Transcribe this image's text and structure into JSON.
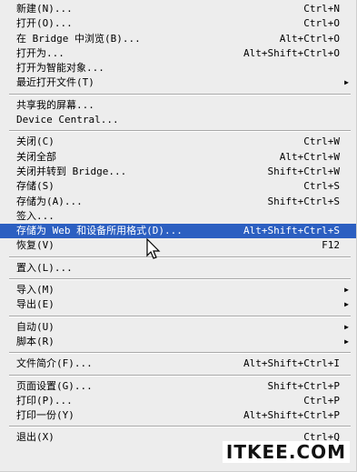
{
  "groups": [
    [
      {
        "label": "新建(N)...",
        "shortcut": "Ctrl+N"
      },
      {
        "label": "打开(O)...",
        "shortcut": "Ctrl+O"
      },
      {
        "label": "在 Bridge 中浏览(B)...",
        "shortcut": "Alt+Ctrl+O"
      },
      {
        "label": "打开为...",
        "shortcut": "Alt+Shift+Ctrl+O"
      },
      {
        "label": "打开为智能对象...",
        "shortcut": ""
      },
      {
        "label": "最近打开文件(T)",
        "shortcut": "",
        "submenu": true
      }
    ],
    [
      {
        "label": "共享我的屏幕...",
        "shortcut": ""
      },
      {
        "label": "Device Central...",
        "shortcut": ""
      }
    ],
    [
      {
        "label": "关闭(C)",
        "shortcut": "Ctrl+W"
      },
      {
        "label": "关闭全部",
        "shortcut": "Alt+Ctrl+W"
      },
      {
        "label": "关闭并转到 Bridge...",
        "shortcut": "Shift+Ctrl+W"
      },
      {
        "label": "存储(S)",
        "shortcut": "Ctrl+S"
      },
      {
        "label": "存储为(A)...",
        "shortcut": "Shift+Ctrl+S"
      },
      {
        "label": "签入...",
        "shortcut": ""
      },
      {
        "label": "存储为 Web 和设备所用格式(D)...",
        "shortcut": "Alt+Shift+Ctrl+S",
        "highlighted": true
      },
      {
        "label": "恢复(V)",
        "shortcut": "F12"
      }
    ],
    [
      {
        "label": "置入(L)...",
        "shortcut": ""
      }
    ],
    [
      {
        "label": "导入(M)",
        "shortcut": "",
        "submenu": true
      },
      {
        "label": "导出(E)",
        "shortcut": "",
        "submenu": true
      }
    ],
    [
      {
        "label": "自动(U)",
        "shortcut": "",
        "submenu": true
      },
      {
        "label": "脚本(R)",
        "shortcut": "",
        "submenu": true
      }
    ],
    [
      {
        "label": "文件简介(F)...",
        "shortcut": "Alt+Shift+Ctrl+I"
      }
    ],
    [
      {
        "label": "页面设置(G)...",
        "shortcut": "Shift+Ctrl+P"
      },
      {
        "label": "打印(P)...",
        "shortcut": "Ctrl+P"
      },
      {
        "label": "打印一份(Y)",
        "shortcut": "Alt+Shift+Ctrl+P"
      }
    ],
    [
      {
        "label": "退出(X)",
        "shortcut": "Ctrl+Q"
      }
    ]
  ],
  "icons": {
    "submenu_arrow": "triangle-right-icon",
    "cursor": "mouse-pointer-icon"
  },
  "watermark": "ITKEE.COM",
  "colors": {
    "menu_bg": "#ededed",
    "highlight_bg": "#2c5fc1",
    "highlight_text": "#ffffff",
    "separator": "#a8a8a8"
  }
}
